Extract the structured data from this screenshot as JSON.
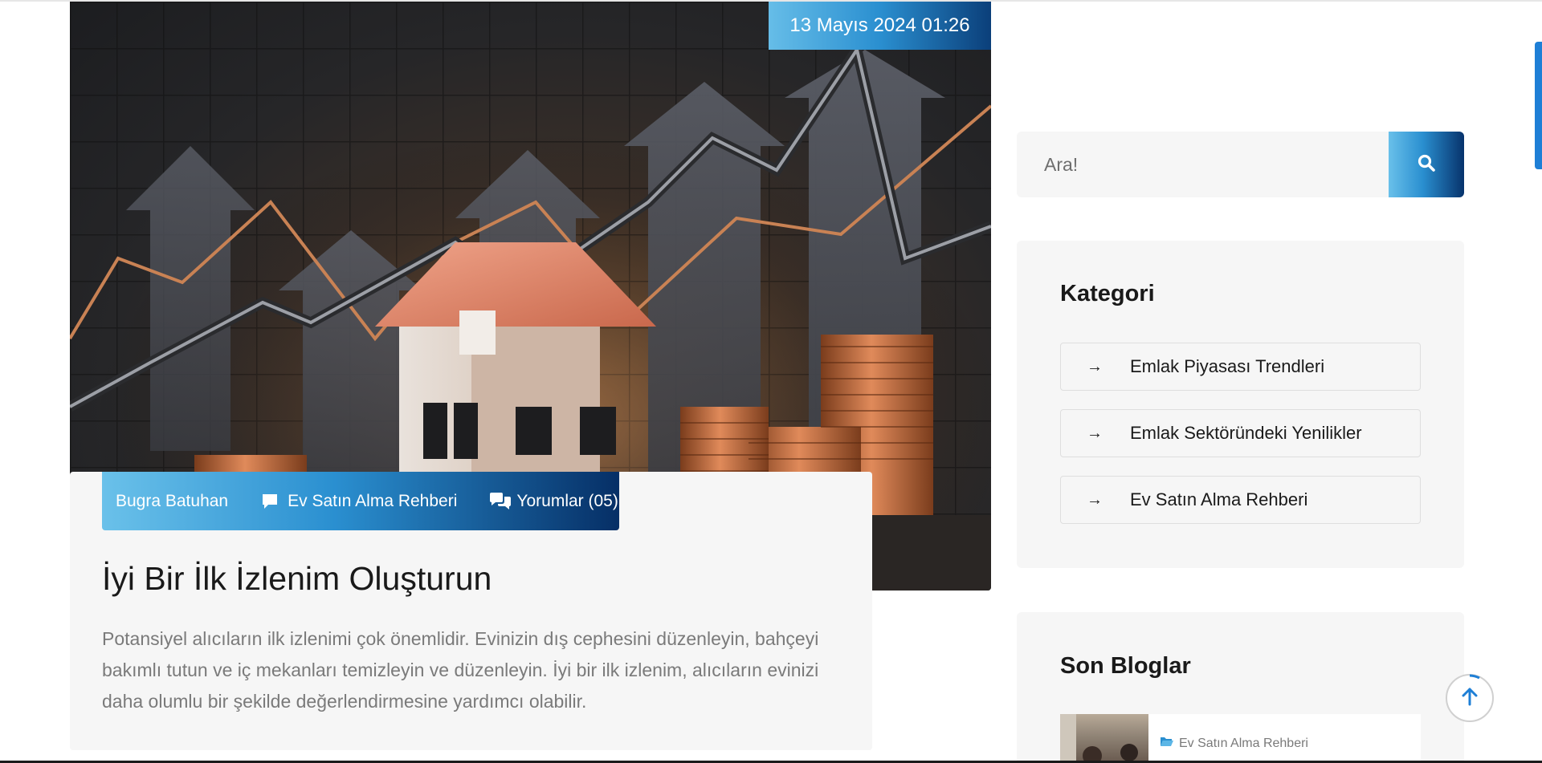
{
  "post": {
    "date": "13 Mayıs 2024 01:26",
    "author": "Bugra Batuhan",
    "category": "Ev Satın Alma Rehberi",
    "comments": "Yorumlar (05)",
    "title": "İyi Bir İlk İzlenim Oluşturun",
    "excerpt": "Potansiyel alıcıların ilk izlenimi çok önemlidir. Evinizin dış cephesini düzenleyin, bahçeyi bakımlı tutun ve iç mekanları temizleyin ve düzenleyin. İyi bir ilk izlenim, alıcıların evinizi daha olumlu bir şekilde değerlendirmesine yardımcı olabilir."
  },
  "search": {
    "placeholder": "Ara!"
  },
  "categories": {
    "title": "Kategori",
    "items": [
      {
        "label": "Emlak Piyasası Trendleri"
      },
      {
        "label": "Emlak Sektöründeki Yenilikler"
      },
      {
        "label": "Ev Satın Alma Rehberi"
      }
    ]
  },
  "recent_blogs": {
    "title": "Son Bloglar",
    "items": [
      {
        "category": "Ev Satın Alma Rehberi"
      }
    ]
  },
  "icons": {
    "comment": "comment-icon",
    "comments": "comments-icon",
    "search": "search-icon",
    "arrow": "arrow-right-icon",
    "folder": "folder-open-icon",
    "scroll_top": "arrow-up-icon"
  },
  "colors": {
    "accent_light": "#66bde8",
    "accent_mid": "#2a8fd0",
    "accent_dark": "#062f66",
    "card_bg": "#f6f6f6",
    "scroll_accent": "#1e7fd6"
  }
}
